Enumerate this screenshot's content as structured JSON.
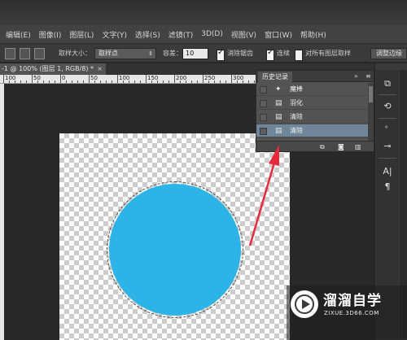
{
  "menubar": {
    "items": [
      "编辑(E)",
      "图像(I)",
      "图层(L)",
      "文字(Y)",
      "选择(S)",
      "滤镜(T)",
      "3D(D)",
      "视图(V)",
      "窗口(W)",
      "帮助(H)"
    ]
  },
  "options": {
    "sample_size_label": "取样大小：",
    "sample_size_value": "取样点",
    "tolerance_label": "容差：",
    "tolerance_value": "10",
    "antialias_label": "消除锯齿",
    "contiguous_label": "连续",
    "all_layers_label": "对所有图层取样",
    "refine_edge_label": "调整边缘"
  },
  "document_tab": {
    "title": "-1 @ 100% (图层 1, RGB/8) *",
    "close": "×"
  },
  "ruler": {
    "labels": [
      "100",
      "50",
      "0",
      "50",
      "100",
      "150",
      "200",
      "250",
      "300",
      "350",
      "400",
      "450",
      "500",
      "550"
    ]
  },
  "history_panel": {
    "title": "历史记录",
    "collapse_icon": "»",
    "menu_icon": "≡",
    "steps": [
      {
        "label": "魔棒",
        "icon": "magic-wand-icon",
        "selected": false
      },
      {
        "label": "羽化",
        "icon": "document-step-icon",
        "selected": false
      },
      {
        "label": "清除",
        "icon": "document-step-icon",
        "selected": false
      },
      {
        "label": "清除",
        "icon": "document-step-icon",
        "selected": true
      }
    ],
    "footer_icons": [
      "new-document-from-state-icon",
      "camera-icon",
      "trash-icon"
    ]
  },
  "canvas": {
    "circle_color": "#2cb4e8",
    "checker_color": "#cccccc"
  },
  "colors": {
    "selection_highlight": "#6f8599",
    "annotation_arrow": "#e8293b"
  },
  "watermark": {
    "title": "溜溜自学",
    "url": "ZIXUE.3D66.COM"
  }
}
